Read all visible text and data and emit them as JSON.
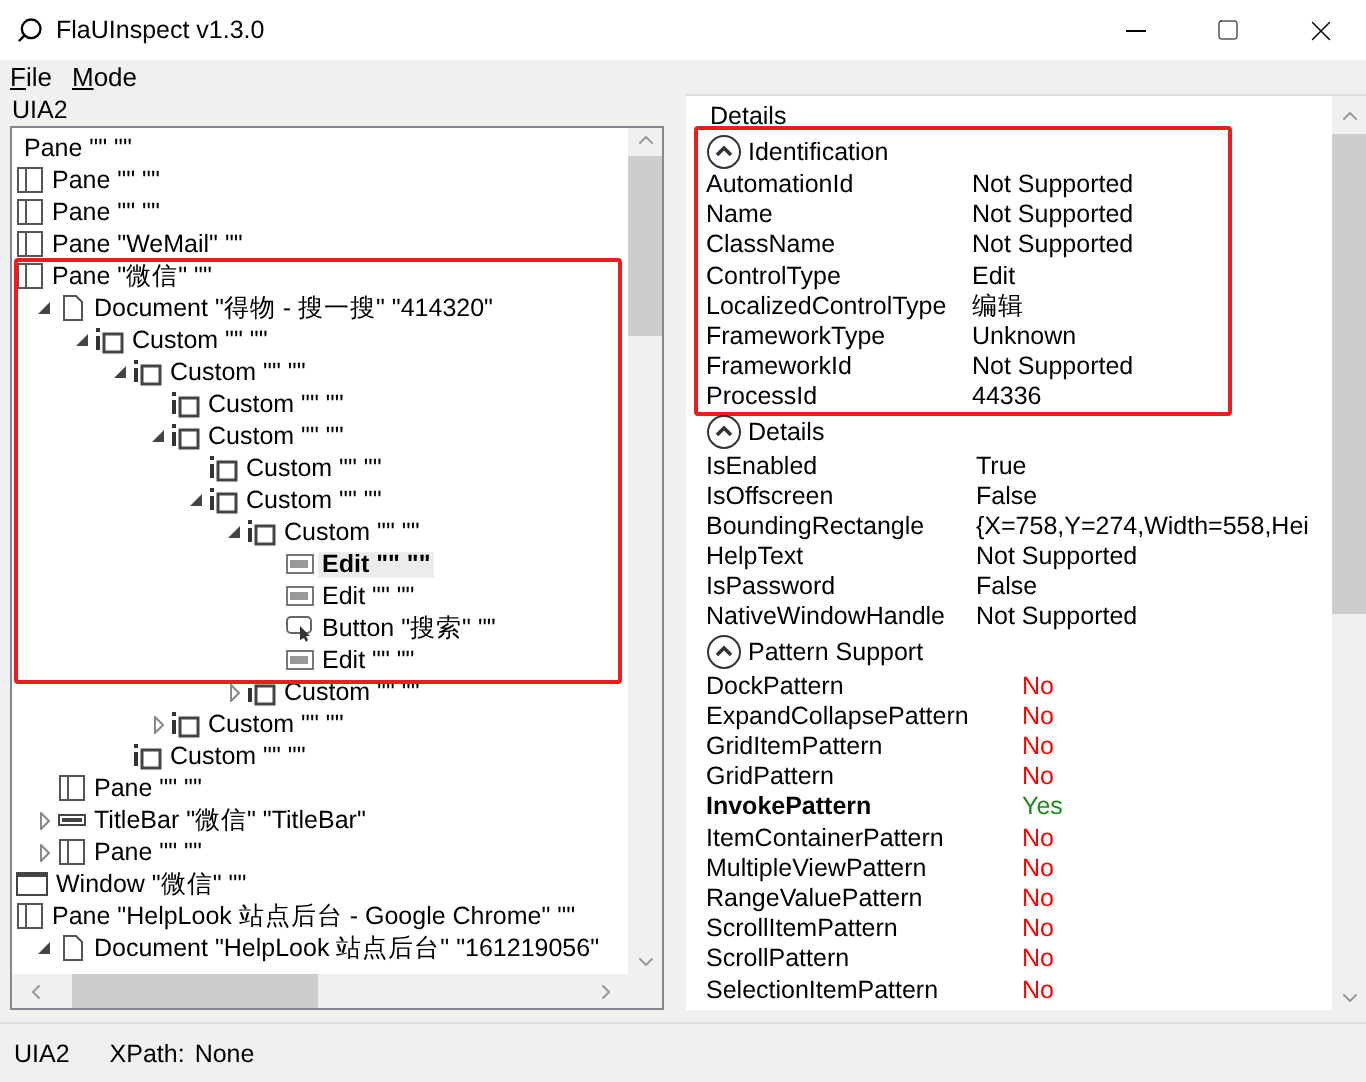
{
  "window": {
    "title": "FlaUInspect v1.3.0"
  },
  "menu": [
    {
      "label": "File"
    },
    {
      "label": "Mode"
    }
  ],
  "tree_panel": {
    "title": "UIA2",
    "framed": true,
    "nodes": [
      {
        "kind": "none",
        "label": "Pane \"\" \"\""
      },
      {
        "kind": "pane",
        "label": "Pane \"\" \"\""
      },
      {
        "kind": "pane",
        "label": "Pane \"\" \"\""
      },
      {
        "kind": "pane",
        "label": "Pane \"WeMail\" \"\""
      },
      {
        "kind": "pane",
        "label": "Pane \"微信\" \"\"",
        "children": [
          {
            "kind": "document",
            "label": "Document \"得物 - 搜一搜\" \"414320\"",
            "expanded": true,
            "children": [
              {
                "kind": "custom",
                "label": "Custom \"\" \"\"",
                "expanded": true,
                "children": [
                  {
                    "kind": "custom",
                    "label": "Custom \"\" \"\"",
                    "expanded": true,
                    "children": [
                      {
                        "kind": "custom",
                        "label": "Custom \"\" \"\""
                      },
                      {
                        "kind": "custom",
                        "label": "Custom \"\" \"\"",
                        "expanded": true,
                        "children": [
                          {
                            "kind": "custom",
                            "label": "Custom \"\" \"\""
                          },
                          {
                            "kind": "custom",
                            "label": "Custom \"\" \"\"",
                            "expanded": true,
                            "children": [
                              {
                                "kind": "custom",
                                "label": "Custom \"\" \"\"",
                                "expanded": true,
                                "children": [
                                  {
                                    "kind": "edit",
                                    "label": "Edit \"\" \"\"",
                                    "selected": true
                                  },
                                  {
                                    "kind": "edit",
                                    "label": "Edit \"\" \"\"",
                                    "selected": false
                                  },
                                  {
                                    "kind": "button",
                                    "label": "Button \"搜索\" \"\"",
                                    "selected": false
                                  },
                                  {
                                    "kind": "edit",
                                    "label": "Edit \"\" \"\"",
                                    "selected": false
                                  }
                                ]
                              },
                              {
                                "kind": "custom",
                                "label": "Custom \"\" \"\"",
                                "expanded": false
                              }
                            ]
                          }
                        ]
                      },
                      {
                        "kind": "custom",
                        "label": "Custom \"\" \"\"",
                        "expanded": false
                      }
                    ]
                  },
                  {
                    "kind": "custom",
                    "label": "Custom \"\" \"\""
                  }
                ]
              }
            ]
          },
          {
            "kind": "pane",
            "label": "Pane \"\" \"\""
          },
          {
            "kind": "titlebar",
            "label": "TitleBar \"微信\" \"TitleBar\"",
            "expanded": false
          },
          {
            "kind": "pane",
            "label": "Pane \"\" \"\"",
            "expanded": false
          }
        ]
      },
      {
        "kind": "window",
        "label": "Window \"微信\" \"\""
      },
      {
        "kind": "pane",
        "label": "Pane \"HelpLook 站点后台 - Google Chrome\" \"\"",
        "children": [
          {
            "kind": "document",
            "label": "Document \"HelpLook 站点后台\" \"161219056\"",
            "expanded": true
          }
        ]
      }
    ]
  },
  "details_panel": {
    "title": "Details",
    "sections": [
      {
        "kind": "properties",
        "title": "Identification",
        "expanded": true,
        "framed": true,
        "rows": [
          {
            "name": "AutomationId",
            "value": "Not Supported"
          },
          {
            "name": "Name",
            "value": "Not Supported"
          },
          {
            "name": "ClassName",
            "value": "Not Supported"
          },
          {
            "name": "ControlType",
            "value": "Edit"
          },
          {
            "name": "LocalizedControlType",
            "value": "编辑"
          },
          {
            "name": "FrameworkType",
            "value": "Unknown"
          },
          {
            "name": "FrameworkId",
            "value": "Not Supported"
          },
          {
            "name": "ProcessId",
            "value": "44336"
          }
        ]
      },
      {
        "kind": "properties",
        "title": "Details",
        "expanded": true,
        "framed": false,
        "rows": [
          {
            "name": "IsEnabled",
            "value": "True"
          },
          {
            "name": "IsOffscreen",
            "value": "False"
          },
          {
            "name": "BoundingRectangle",
            "value": "{X=758,Y=274,Width=558,Hei"
          },
          {
            "name": "HelpText",
            "value": "Not Supported"
          },
          {
            "name": "IsPassword",
            "value": "False"
          },
          {
            "name": "NativeWindowHandle",
            "value": "Not Supported"
          }
        ]
      },
      {
        "kind": "patterns",
        "title": "Pattern Support",
        "expanded": true,
        "framed": false,
        "rows": [
          {
            "name": "DockPattern",
            "value": "No",
            "supported": false
          },
          {
            "name": "ExpandCollapsePattern",
            "value": "No",
            "supported": false
          },
          {
            "name": "GridItemPattern",
            "value": "No",
            "supported": false
          },
          {
            "name": "GridPattern",
            "value": "No",
            "supported": false
          },
          {
            "name": "InvokePattern",
            "value": "Yes",
            "supported": true
          },
          {
            "name": "ItemContainerPattern",
            "value": "No",
            "supported": false
          },
          {
            "name": "MultipleViewPattern",
            "value": "No",
            "supported": false
          },
          {
            "name": "RangeValuePattern",
            "value": "No",
            "supported": false
          },
          {
            "name": "ScrollItemPattern",
            "value": "No",
            "supported": false
          },
          {
            "name": "ScrollPattern",
            "value": "No",
            "supported": false
          },
          {
            "name": "SelectionItemPattern",
            "value": "No",
            "supported": false
          }
        ]
      }
    ]
  },
  "status_bar": {
    "mode": "UIA2",
    "xpath_label": "XPath:",
    "xpath_value": "None"
  }
}
